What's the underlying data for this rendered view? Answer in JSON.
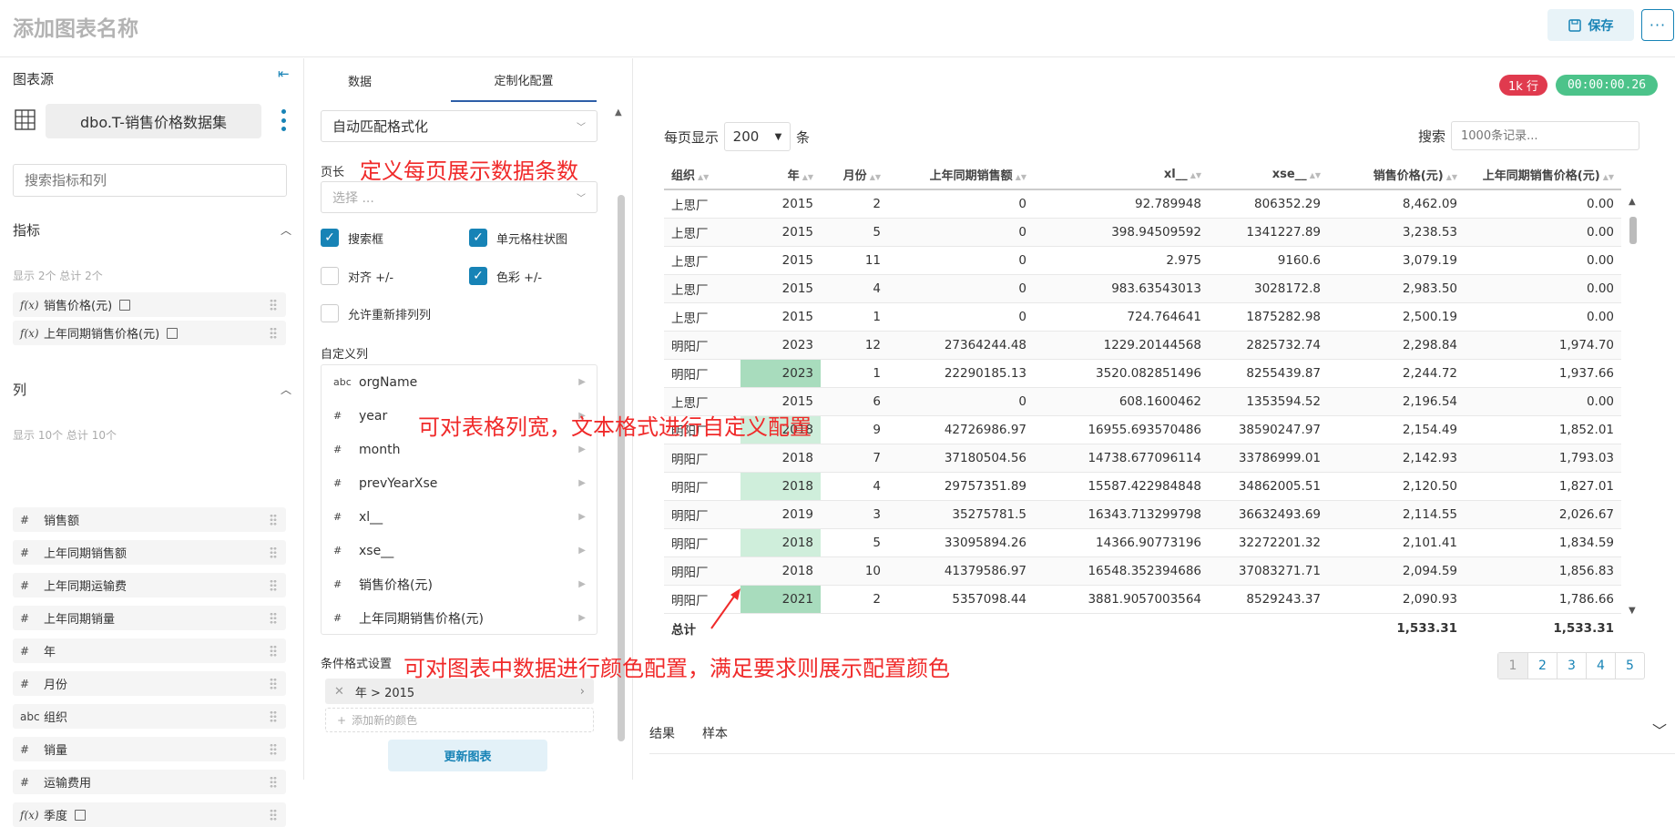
{
  "header": {
    "title": "添加图表名称",
    "save_label": "保存",
    "more_label": "···"
  },
  "left": {
    "source_label": "图表源",
    "dataset": "dbo.T-销售价格数据集",
    "search_placeholder": "搜索指标和列",
    "metrics": {
      "title": "指标",
      "count": "显示 2个 总计 2个",
      "items": [
        {
          "icon": "f(x)",
          "label": "销售价格(元)"
        },
        {
          "icon": "f(x)",
          "label": "上年同期销售价格(元)"
        }
      ]
    },
    "columns": {
      "title": "列",
      "count": "显示 10个 总计 10个",
      "items": [
        {
          "icon": "#",
          "label": "销售额"
        },
        {
          "icon": "#",
          "label": "上年同期销售额"
        },
        {
          "icon": "#",
          "label": "上年同期运输费"
        },
        {
          "icon": "#",
          "label": "上年同期销量"
        },
        {
          "icon": "#",
          "label": "年"
        },
        {
          "icon": "#",
          "label": "月份"
        },
        {
          "icon": "abc",
          "label": "组织"
        },
        {
          "icon": "#",
          "label": "销量"
        },
        {
          "icon": "#",
          "label": "运输费用"
        },
        {
          "icon": "f(x)",
          "label": "季度"
        }
      ]
    }
  },
  "mid": {
    "tabs": [
      "数据",
      "定制化配置"
    ],
    "format_select": "自动匹配格式化",
    "page_length_label": "页长",
    "page_length_placeholder": "选择 ...",
    "checkboxes": [
      {
        "label": "搜索框",
        "checked": true
      },
      {
        "label": "单元格柱状图",
        "checked": true
      },
      {
        "label": "对齐 +/-",
        "checked": false
      },
      {
        "label": "色彩 +/-",
        "checked": true
      },
      {
        "label": "允许重新排列列",
        "checked": false
      }
    ],
    "custom_columns_label": "自定义列",
    "custom_columns": [
      {
        "icon": "abc",
        "name": "orgName"
      },
      {
        "icon": "#",
        "name": "year"
      },
      {
        "icon": "#",
        "name": "month"
      },
      {
        "icon": "#",
        "name": "prevYearXse"
      },
      {
        "icon": "#",
        "name": "xl__"
      },
      {
        "icon": "#",
        "name": "xse__"
      },
      {
        "icon": "#",
        "name": "销售价格(元)"
      },
      {
        "icon": "#",
        "name": "上年同期销售价格(元)"
      }
    ],
    "conditional_label": "条件格式设置",
    "condition": "年 > 2015",
    "add_color": "添加新的颜色",
    "update_button": "更新图表"
  },
  "right": {
    "rows_badge": "1k 行",
    "time_badge": "00:00:00.26",
    "badge_colors": {
      "rows": "#e03a4e",
      "time": "#4cc38a"
    },
    "per_page_label": "每页显示",
    "per_page_value": "200",
    "per_page_unit": "条",
    "search_label": "搜索",
    "search_placeholder": "1000条记录...",
    "table": {
      "headers": [
        "组织",
        "年",
        "月份",
        "上年同期销售额",
        "xl__",
        "xse__",
        "销售价格(元)",
        "上年同期销售价格(元)"
      ],
      "rows": [
        [
          "上思厂",
          "2015",
          "2",
          "0",
          "92.789948",
          "806352.29",
          "8,462.09",
          "0.00"
        ],
        [
          "上思厂",
          "2015",
          "5",
          "0",
          "398.94509592",
          "1341227.89",
          "3,238.53",
          "0.00"
        ],
        [
          "上思厂",
          "2015",
          "11",
          "0",
          "2.975",
          "9160.6",
          "3,079.19",
          "0.00"
        ],
        [
          "上思厂",
          "2015",
          "4",
          "0",
          "983.63543013",
          "3028172.8",
          "2,983.50",
          "0.00"
        ],
        [
          "上思厂",
          "2015",
          "1",
          "0",
          "724.764641",
          "1875282.98",
          "2,500.19",
          "0.00"
        ],
        [
          "明阳厂",
          "2023",
          "12",
          "27364244.48",
          "1229.20144568",
          "2825732.74",
          "2,298.84",
          "1,974.70"
        ],
        [
          "明阳厂",
          "2023",
          "1",
          "22290185.13",
          "3520.082851496",
          "8255439.87",
          "2,244.72",
          "1,937.66"
        ],
        [
          "上思厂",
          "2015",
          "6",
          "0",
          "608.1600462",
          "1353594.52",
          "2,196.54",
          "0.00"
        ],
        [
          "明阳厂",
          "2018",
          "9",
          "42726986.97",
          "16955.693570486",
          "38590247.97",
          "2,154.49",
          "1,852.01"
        ],
        [
          "明阳厂",
          "2018",
          "7",
          "37180504.56",
          "14738.677096114",
          "33786999.01",
          "2,142.93",
          "1,793.03"
        ],
        [
          "明阳厂",
          "2018",
          "4",
          "29757351.89",
          "15587.422984848",
          "34862005.51",
          "2,120.50",
          "1,827.01"
        ],
        [
          "明阳厂",
          "2019",
          "3",
          "35275781.5",
          "16343.713299798",
          "36632493.69",
          "2,114.55",
          "2,026.67"
        ],
        [
          "明阳厂",
          "2018",
          "5",
          "33095894.26",
          "14366.90773196",
          "32272201.32",
          "2,101.41",
          "1,834.59"
        ],
        [
          "明阳厂",
          "2018",
          "10",
          "41379586.97",
          "16548.352394686",
          "37083271.71",
          "2,094.59",
          "1,856.83"
        ],
        [
          "明阳厂",
          "2021",
          "2",
          "5357098.44",
          "3881.9057003564",
          "8529243.37",
          "2,090.93",
          "1,786.66"
        ]
      ],
      "total_label": "总计",
      "total_price": "1,533.31",
      "total_prev_price": "1,533.31"
    },
    "pages": [
      "1",
      "2",
      "3",
      "4",
      "5"
    ],
    "result_tabs": [
      "结果",
      "样本"
    ]
  },
  "annotations": {
    "page_length": "定义每页展示数据条数",
    "column_config": "可对表格列宽，文本格式进行自定义配置",
    "color_config": "可对图表中数据进行颜色配置，满足要求则展示配置颜色"
  }
}
